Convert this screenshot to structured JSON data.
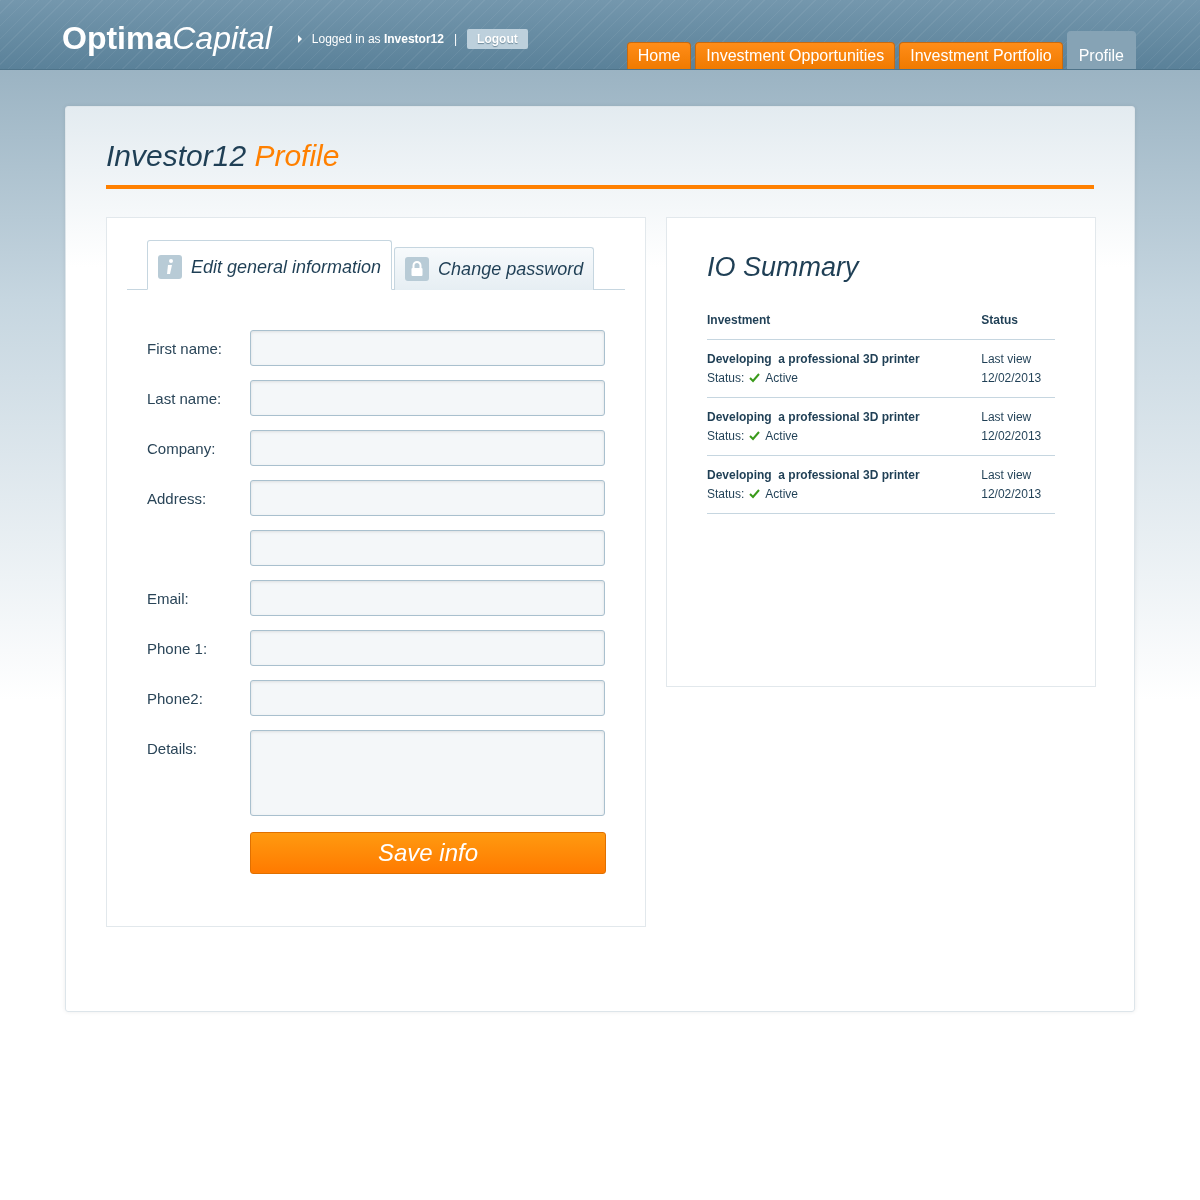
{
  "header": {
    "logo": {
      "first": "Optima",
      "second": "Capital"
    },
    "login_text": "Logged in as **Investor12**",
    "separator": "|",
    "logout": "Logout"
  },
  "nav": [
    {
      "label": "Home",
      "selected": false
    },
    {
      "label": "Investment Opportunities",
      "selected": false
    },
    {
      "label": "Investment Portfolio",
      "selected": false
    },
    {
      "label": "Profile",
      "selected": true
    }
  ],
  "page_title": {
    "name": "Investor12",
    "word": "Profile"
  },
  "form_tabs": [
    {
      "label": "Edit general information",
      "selected": true
    },
    {
      "label": "Change password",
      "selected": false
    }
  ],
  "fields": [
    {
      "label": "First name:",
      "kind": "input"
    },
    {
      "label": "Last name:",
      "kind": "input"
    },
    {
      "label": "Company:",
      "kind": "input"
    },
    {
      "label": "Address:",
      "kind": "input"
    },
    {
      "kind": "input"
    },
    {
      "label": "Email:",
      "kind": "input"
    },
    {
      "label": "Phone 1:",
      "kind": "input"
    },
    {
      "label": "Phone2:",
      "kind": "input"
    },
    {
      "label": "Details:",
      "kind": "textarea"
    }
  ],
  "save_button": "Save info",
  "summary": {
    "title": "IO Summary",
    "columns": [
      "Investment",
      "Status"
    ],
    "rows": [
      {
        "name": "Developing  a professional 3D printer",
        "status_label": "Status:",
        "status": "Active",
        "view_label": "Last view",
        "date": "12/02/2013"
      },
      {
        "name": "Developing  a professional 3D printer",
        "status_label": "Status:",
        "status": "Active",
        "view_label": "Last view",
        "date": "12/02/2013"
      },
      {
        "name": "Developing  a professional 3D printer",
        "status_label": "Status:",
        "status": "Active",
        "view_label": "Last view",
        "date": "12/02/2013"
      }
    ]
  }
}
